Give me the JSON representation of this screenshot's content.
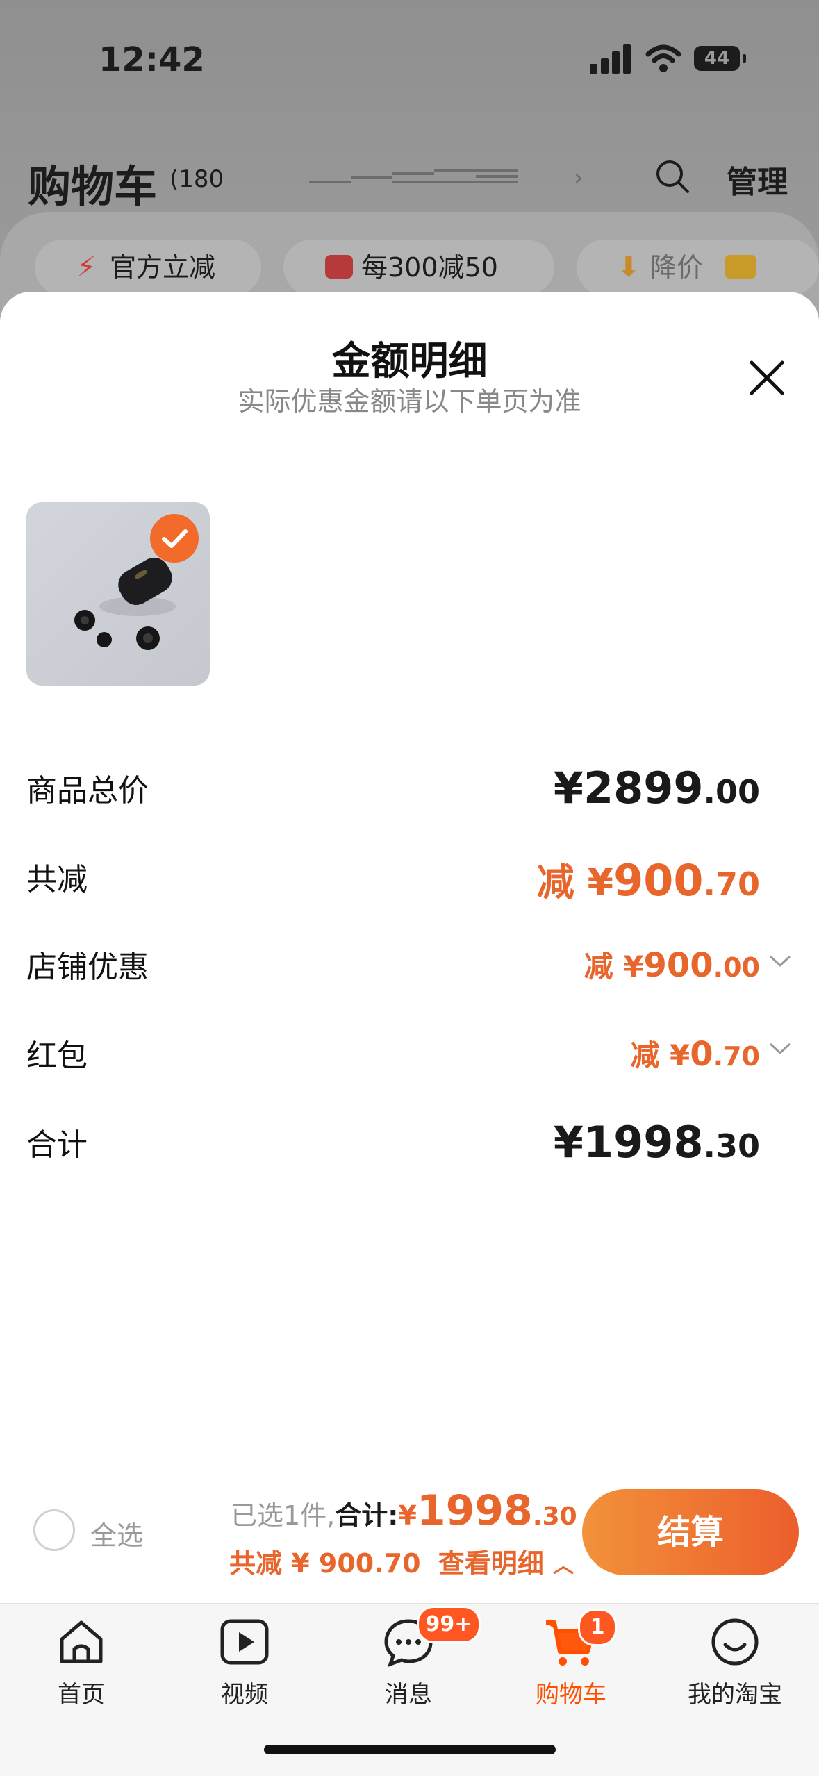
{
  "status_bar": {
    "time": "12:42",
    "battery": "44"
  },
  "cart_header": {
    "title": "购物车",
    "count": "(180",
    "manage_label": "管理"
  },
  "chips": [
    {
      "label": "官方立减"
    },
    {
      "label": "每300减50"
    },
    {
      "label": "降价"
    }
  ],
  "sheet": {
    "title": "金额明细",
    "subtitle": "实际优惠金额请以下单页为准"
  },
  "breakdown": {
    "goods_total": {
      "label": "商品总价",
      "currency": "¥",
      "integer": "2899",
      "decimal": ".00"
    },
    "total_discount": {
      "label": "共减",
      "prefix": "减 ¥",
      "integer": "900",
      "decimal": ".70"
    },
    "store_discount": {
      "label": "店铺优惠",
      "prefix": "减 ¥",
      "integer": "900",
      "decimal": ".00"
    },
    "red_packet": {
      "label": "红包",
      "prefix": "减 ¥",
      "integer": "0",
      "decimal": ".70"
    },
    "sum": {
      "label": "合计",
      "currency": "¥",
      "integer": "1998",
      "decimal": ".30"
    }
  },
  "checkout_bar": {
    "select_all_label": "全选",
    "selected_text": "已选1件,",
    "total_label": "合计:",
    "currency": "¥",
    "total_integer": "1998",
    "total_decimal": ".30",
    "saved_text": "共减 ¥ 900.70",
    "details_label": "查看明细",
    "pay_label": "结算"
  },
  "tabbar": {
    "items": [
      {
        "label": "首页",
        "badge": ""
      },
      {
        "label": "视频",
        "badge": ""
      },
      {
        "label": "消息",
        "badge": "99+"
      },
      {
        "label": "购物车",
        "badge": "1"
      },
      {
        "label": "我的淘宝",
        "badge": ""
      }
    ],
    "active_color": "#ff5000"
  }
}
